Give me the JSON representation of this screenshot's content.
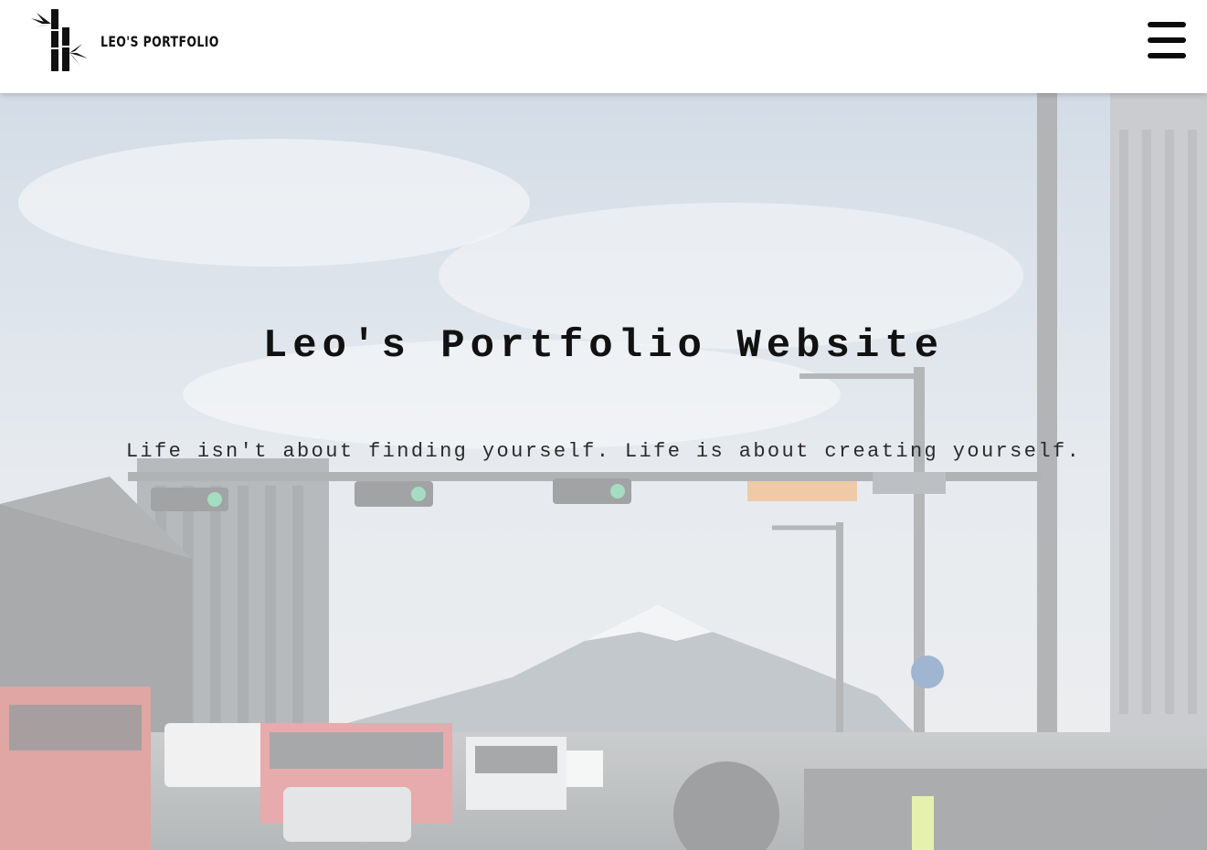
{
  "header": {
    "brand_text": "LEO'S PORTFOLIO",
    "logo_icon": "bamboo-logo-icon",
    "menu_icon": "hamburger-menu-icon"
  },
  "hero": {
    "title": "Leo's Portfolio Website",
    "quote": "Life isn't about finding yourself. Life is about creating yourself."
  },
  "colors": {
    "header_bg": "#ffffff",
    "text_dark": "#111111",
    "overlay": "rgba(255,255,255,0.55)"
  }
}
